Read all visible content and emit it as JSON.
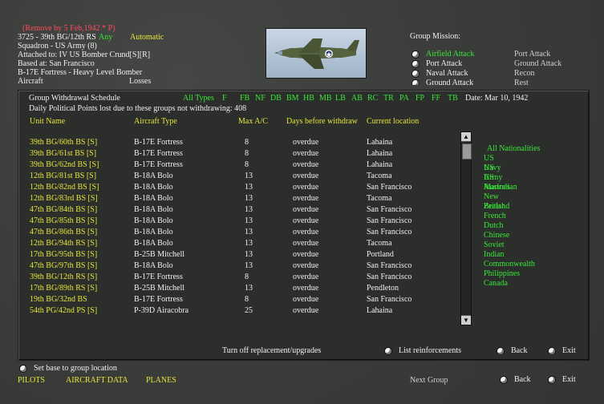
{
  "header": {
    "remove": "(Remove by  5 Feb,1942 * P)",
    "unit": "3725 - 39th BG/12th RS",
    "any": "Any",
    "automatic": "Automatic",
    "squadron": "Squadron - US Army (8)",
    "attached": "Attached to:  IV US Bomber Crund[S][R]",
    "based": "Based at: San Francisco",
    "aircraft": "B-17E Fortress - Heavy Level Bomber",
    "aircraft_col": "Aircraft",
    "losses_col": "Losses"
  },
  "mission": {
    "title": "Group Mission:",
    "left": [
      "Airfield Attack",
      "Port Attack",
      "Naval Attack",
      "Ground Attack"
    ],
    "right": [
      "Port Attack",
      "Ground Attack",
      "Recon",
      "Rest"
    ]
  },
  "panel": {
    "title": "Group Withdrawal Schedule",
    "filter_all": "All Types",
    "filters": [
      "F",
      "FB",
      "NF",
      "DB",
      "BM",
      "HB",
      "MB",
      "LB",
      "AB",
      "RC",
      "TR",
      "PA",
      "FP",
      "FF",
      "TB"
    ],
    "date": "Date: Mar 10, 1942",
    "points": "Daily Political Points lost due to these groups not withdrawing: 408",
    "columns": [
      "Unit Name",
      "Aircraft Type",
      "Max A/C",
      "Days before withdraw",
      "Current location"
    ],
    "rows": [
      {
        "unit": "39th BG/60th BS [S]",
        "aircraft": "B-17E Fortress",
        "max": "8",
        "days": "overdue",
        "loc": "Lahaina"
      },
      {
        "unit": "39th BG/61st BS [S]",
        "aircraft": "B-17E Fortress",
        "max": "8",
        "days": "overdue",
        "loc": "Lahaina"
      },
      {
        "unit": "39th BG/62nd BS [S]",
        "aircraft": "B-17E Fortress",
        "max": "8",
        "days": "overdue",
        "loc": "Lahaina"
      },
      {
        "unit": "12th BG/81st BS [S]",
        "aircraft": "B-18A Bolo",
        "max": "13",
        "days": "overdue",
        "loc": "Tacoma"
      },
      {
        "unit": "12th BG/82nd BS [S]",
        "aircraft": "B-18A Bolo",
        "max": "13",
        "days": "overdue",
        "loc": "San Francisco"
      },
      {
        "unit": "12th BG/83rd BS [S]",
        "aircraft": "B-18A Bolo",
        "max": "13",
        "days": "overdue",
        "loc": "Tacoma"
      },
      {
        "unit": "47th BG/84th BS [S]",
        "aircraft": "B-18A Bolo",
        "max": "13",
        "days": "overdue",
        "loc": "San Francisco"
      },
      {
        "unit": "47th BG/85th BS [S]",
        "aircraft": "B-18A Bolo",
        "max": "13",
        "days": "overdue",
        "loc": "San Francisco"
      },
      {
        "unit": "47th BG/86th BS [S]",
        "aircraft": "B-18A Bolo",
        "max": "13",
        "days": "overdue",
        "loc": "San Francisco"
      },
      {
        "unit": "12th BG/94th RS [S]",
        "aircraft": "B-18A Bolo",
        "max": "13",
        "days": "overdue",
        "loc": "Tacoma"
      },
      {
        "unit": "17th BG/95th BS [S]",
        "aircraft": "B-25B Mitchell",
        "max": "13",
        "days": "overdue",
        "loc": "Portland"
      },
      {
        "unit": "47th BG/97th BS [S]",
        "aircraft": "B-18A Bolo",
        "max": "13",
        "days": "overdue",
        "loc": "San Francisco"
      },
      {
        "unit": "39th BG/12th RS [S]",
        "aircraft": "B-17E Fortress",
        "max": "8",
        "days": "overdue",
        "loc": "San Francisco"
      },
      {
        "unit": "17th BG/89th RS [S]",
        "aircraft": "B-25B Mitchell",
        "max": "13",
        "days": "overdue",
        "loc": "Pendleton"
      },
      {
        "unit": "19th BG/32nd BS",
        "aircraft": "B-17E Fortress",
        "max": "8",
        "days": "overdue",
        "loc": "San Francisco"
      },
      {
        "unit": "54th PG/42nd PS [S]",
        "aircraft": "P-39D Airacobra",
        "max": "25",
        "days": "overdue",
        "loc": "Lahaina"
      }
    ],
    "nationalities_all": "All Nationalities",
    "nationalities": [
      "US Navy",
      "US Army",
      "US Marines",
      "Australian",
      "New Zealand",
      "British",
      "French",
      "Dutch",
      "Chinese",
      "Soviet",
      "Indian",
      "Commonwealth",
      "Philippines",
      "Canada"
    ],
    "turn_off": "Turn off replacement/upgrades",
    "list_reinforcements": "List reinforcements",
    "back": "Back",
    "exit": "Exit"
  },
  "footer": {
    "set_base": "Set base to group location",
    "pilots": "PILOTS",
    "aircraft_data": "AIRCRAFT DATA",
    "planes": "PLANES",
    "next_group": "Next Group",
    "back": "Back",
    "exit": "Exit"
  },
  "colors": {
    "header_yellow": "#e6e63a",
    "filter_green": "#39e639",
    "remove_red": "#ff4a5a",
    "background": "#3b3d3b"
  }
}
